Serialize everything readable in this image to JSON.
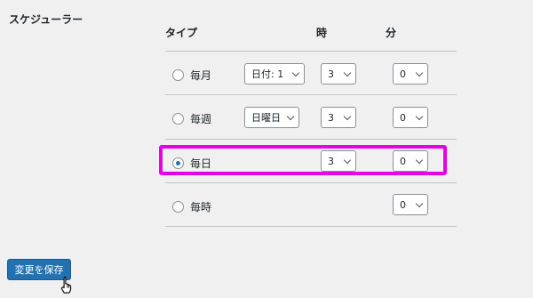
{
  "section_title": "スケジューラー",
  "headers": {
    "type": "タイプ",
    "hour": "時",
    "minute": "分"
  },
  "rows": [
    {
      "label": "毎月",
      "checked": false,
      "day_select": "日付: 1",
      "hour": "3",
      "minute": "0"
    },
    {
      "label": "毎週",
      "checked": false,
      "day_select": "日曜日",
      "hour": "3",
      "minute": "0"
    },
    {
      "label": "毎日",
      "checked": true,
      "hour": "3",
      "minute": "0"
    },
    {
      "label": "毎時",
      "checked": false,
      "minute": "0"
    }
  ],
  "save_button": "変更を保存",
  "colors": {
    "primary": "#2271b1",
    "highlight": "#e600e6",
    "background": "#f0f0f1"
  },
  "icons": {
    "cursor": "hand-pointer-icon",
    "dropdown": "chevron-down-icon"
  }
}
